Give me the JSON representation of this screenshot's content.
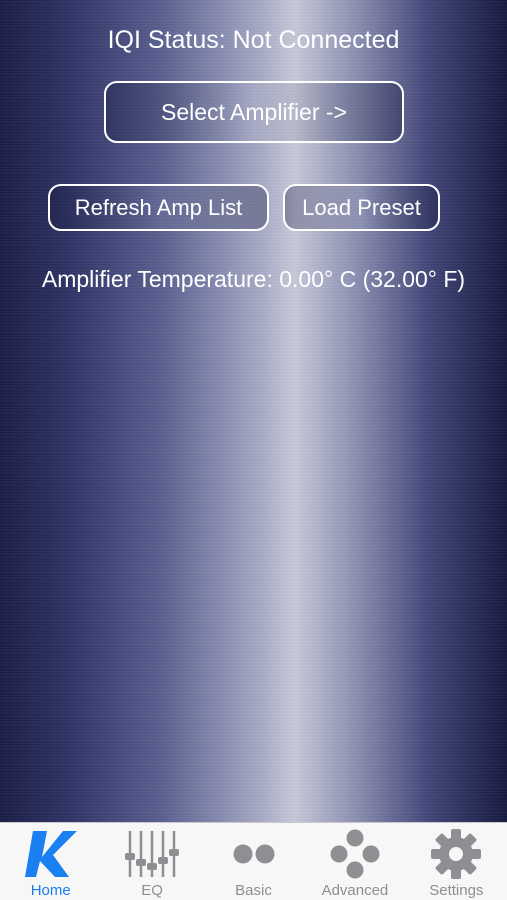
{
  "status": {
    "text": "IQI Status: Not Connected"
  },
  "buttons": {
    "select_amplifier": "Select Amplifier ->",
    "refresh_amp_list": "Refresh Amp List",
    "load_preset": "Load Preset"
  },
  "temperature": {
    "text": "Amplifier Temperature: 0.00° C (32.00° F)"
  },
  "tabbar": {
    "active": "Home",
    "active_color": "#1a7ff0",
    "inactive_color": "#8e8e93",
    "tabs": [
      {
        "label": "Home",
        "icon": "k-logo-icon"
      },
      {
        "label": "EQ",
        "icon": "sliders-icon"
      },
      {
        "label": "Basic",
        "icon": "two-dots-icon"
      },
      {
        "label": "Advanced",
        "icon": "dots-cluster-icon"
      },
      {
        "label": "Settings",
        "icon": "gear-icon"
      }
    ]
  }
}
